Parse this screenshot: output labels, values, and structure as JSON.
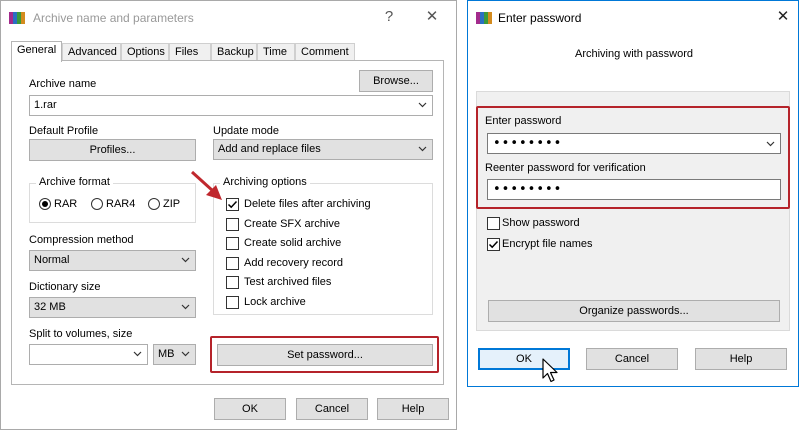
{
  "colors": {
    "highlight": "#b5232a",
    "arrow": "#c0282e",
    "accent": "#0078d7"
  },
  "archive_dialog": {
    "title": "Archive name and parameters",
    "help_icon": "question-mark-icon",
    "close_icon": "close-icon",
    "tabs": [
      "General",
      "Advanced",
      "Options",
      "Files",
      "Backup",
      "Time",
      "Comment"
    ],
    "active_tab": "General",
    "archive_name_label": "Archive name",
    "archive_name_value": "1.rar",
    "browse_button": "Browse...",
    "default_profile_label": "Default Profile",
    "profiles_button": "Profiles...",
    "update_mode_label": "Update mode",
    "update_mode_value": "Add and replace files",
    "archive_format_label": "Archive format",
    "formats": [
      {
        "label": "RAR",
        "selected": true
      },
      {
        "label": "RAR4",
        "selected": false
      },
      {
        "label": "ZIP",
        "selected": false
      }
    ],
    "compression_method_label": "Compression method",
    "compression_method_value": "Normal",
    "dictionary_size_label": "Dictionary size",
    "dictionary_size_value": "32 MB",
    "split_label": "Split to volumes, size",
    "split_value": "",
    "split_unit": "MB",
    "archiving_options_label": "Archiving options",
    "options": [
      {
        "label": "Delete files after archiving",
        "checked": true
      },
      {
        "label": "Create SFX archive",
        "checked": false
      },
      {
        "label": "Create solid archive",
        "checked": false
      },
      {
        "label": "Add recovery record",
        "checked": false
      },
      {
        "label": "Test archived files",
        "checked": false
      },
      {
        "label": "Lock archive",
        "checked": false
      }
    ],
    "set_password_button": "Set password...",
    "ok_button": "OK",
    "cancel_button": "Cancel",
    "help_button": "Help"
  },
  "password_dialog": {
    "title": "Enter password",
    "close_icon": "close-icon",
    "subtitle": "Archiving with password",
    "enter_label": "Enter password",
    "enter_value": "••••••••",
    "reenter_label": "Reenter password for verification",
    "reenter_value": "••••••••",
    "show_password_label": "Show password",
    "show_password_checked": false,
    "encrypt_names_label": "Encrypt file names",
    "encrypt_names_checked": true,
    "organize_button": "Organize passwords...",
    "ok_button": "OK",
    "cancel_button": "Cancel",
    "help_button": "Help"
  }
}
